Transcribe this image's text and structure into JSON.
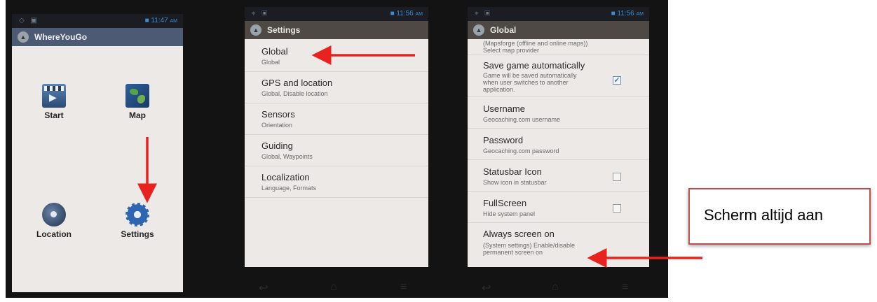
{
  "colors": {
    "arrow": "#e8221e",
    "annotation_border": "#c0504d",
    "checkbox_blue": "#3d7fd6",
    "titlebar_blue": "#4d5a73",
    "titlebar_brown": "#4e4944"
  },
  "screen1": {
    "clock": "11:47",
    "clock_suffix": "AM",
    "app_title": "WhereYouGo",
    "tiles": [
      {
        "label": "Start",
        "icon": "clapperboard-icon"
      },
      {
        "label": "Map",
        "icon": "globe-map-icon"
      },
      {
        "label": "Location",
        "icon": "satellite-dish-icon"
      },
      {
        "label": "Settings",
        "icon": "gear-icon"
      }
    ]
  },
  "screen2": {
    "clock": "11:56",
    "clock_suffix": "AM",
    "title": "Settings",
    "items": [
      {
        "title": "Global",
        "summary": "Global"
      },
      {
        "title": "GPS and location",
        "summary": "Global, Disable location"
      },
      {
        "title": "Sensors",
        "summary": "Orientation"
      },
      {
        "title": "Guiding",
        "summary": "Global, Waypoints"
      },
      {
        "title": "Localization",
        "summary": "Language, Formats"
      }
    ]
  },
  "screen3": {
    "clock": "11:56",
    "clock_suffix": "AM",
    "title": "Global",
    "partial_summary": "(Mapsforge (offline and online maps))\nSelect map provider",
    "prefs": [
      {
        "title": "Save game automatically",
        "summary": "Game will be saved automatically\nwhen user switches to another\napplication.",
        "checkbox": true,
        "checked": true
      },
      {
        "title": "Username",
        "summary": "Geocaching.com username",
        "checkbox": false
      },
      {
        "title": "Password",
        "summary": "Geocaching.com password",
        "checkbox": false
      },
      {
        "title": "Statusbar Icon",
        "summary": "Show icon in statusbar",
        "checkbox": true,
        "checked": false
      },
      {
        "title": "FullScreen",
        "summary": "Hide system panel",
        "checkbox": true,
        "checked": false
      },
      {
        "title": "Always screen on",
        "summary": "(System settings) Enable/disable\npermanent screen on",
        "checkbox": false
      }
    ]
  },
  "annotation": {
    "text": "Scherm altijd aan"
  }
}
